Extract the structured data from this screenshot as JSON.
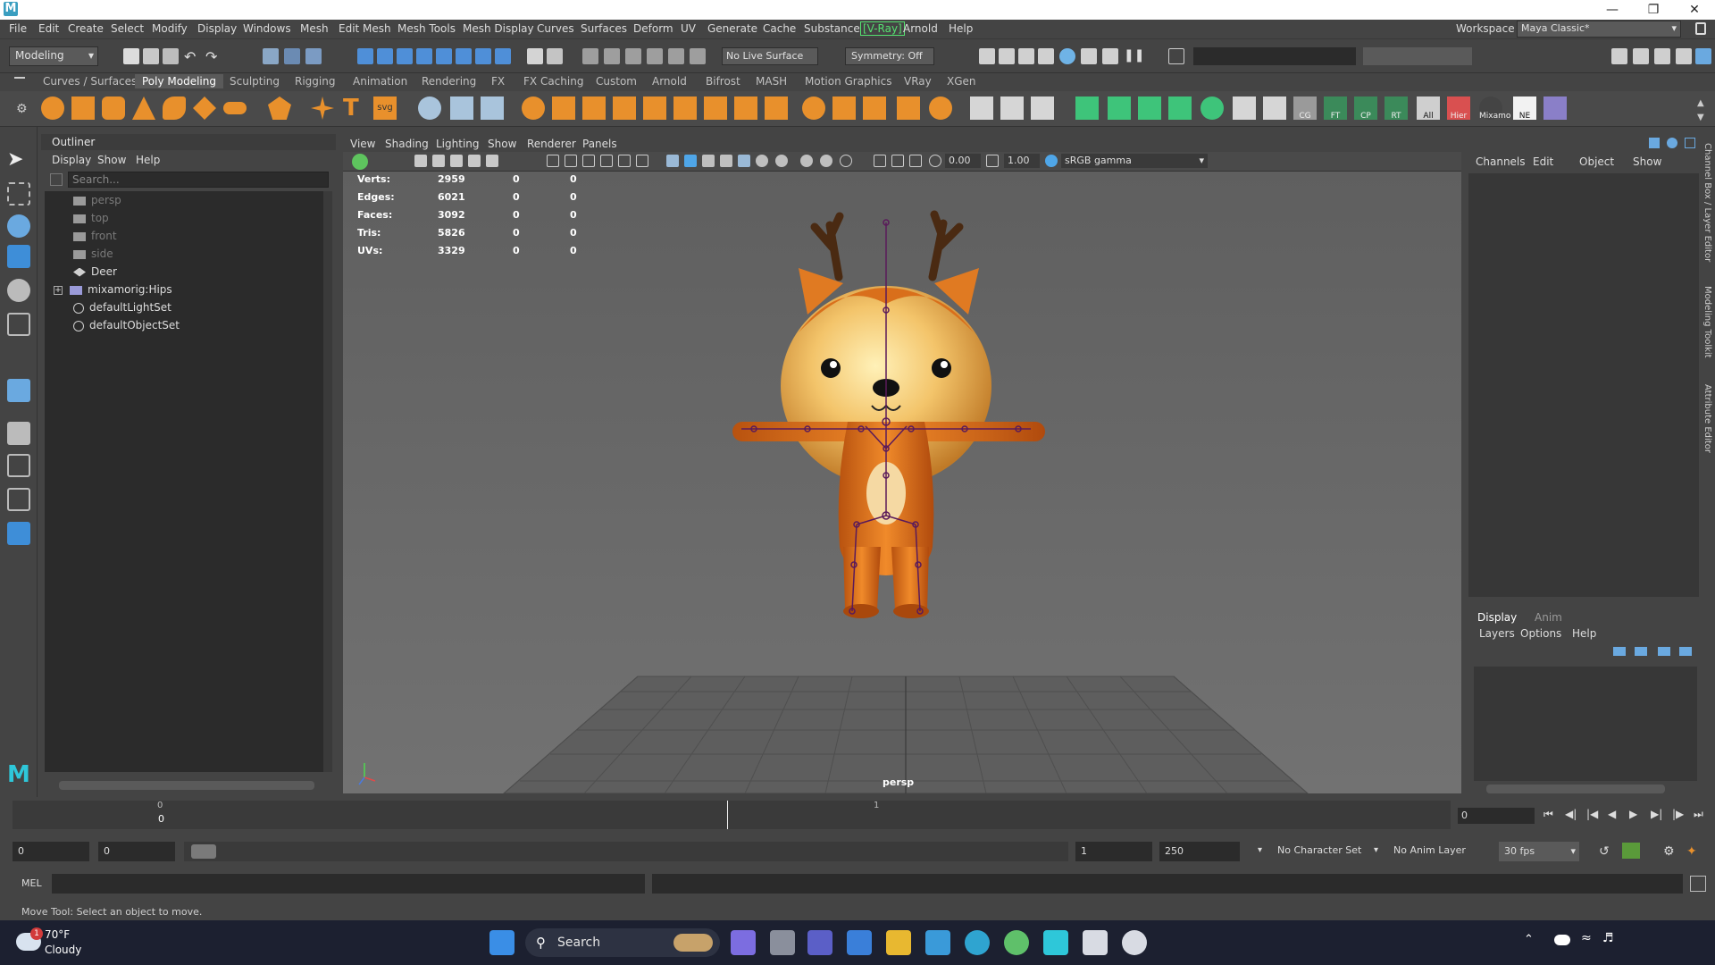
{
  "titlebar": {
    "app_icon": "M",
    "minimize_icon": "minimize-icon",
    "maximize_icon": "restore-icon",
    "close_icon": "close-icon"
  },
  "menubar": {
    "items": [
      "File",
      "Edit",
      "Create",
      "Select",
      "Modify",
      "Display",
      "Windows",
      "Mesh",
      "Edit Mesh",
      "Mesh Tools",
      "Mesh Display",
      "Curves",
      "Surfaces",
      "Deform",
      "UV",
      "Generate",
      "Cache",
      "Substance",
      "[V-Ray]",
      "Arnold",
      "Help"
    ],
    "workspace_label": "Workspace :",
    "workspace_value": "Maya Classic*"
  },
  "statusline": {
    "menuset": "Modeling",
    "live_surface": "No Live Surface",
    "symmetry": "Symmetry: Off"
  },
  "shelf": {
    "tabs": [
      "Curves / Surfaces",
      "Poly Modeling",
      "Sculpting",
      "Rigging",
      "Animation",
      "Rendering",
      "FX",
      "FX Caching",
      "Custom",
      "Arnold",
      "Bifrost",
      "MASH",
      "Motion Graphics",
      "VRay",
      "XGen"
    ],
    "active_tab": "Poly Modeling",
    "labeled_icons": [
      "CG",
      "FT",
      "CP",
      "RT",
      "All",
      "Hier",
      "Mixamo",
      "NE"
    ]
  },
  "outliner": {
    "title": "Outliner",
    "menu": [
      "Display",
      "Show",
      "Help"
    ],
    "search_placeholder": "Search...",
    "items": [
      {
        "label": "persp",
        "icon": "camera-icon",
        "dim": true
      },
      {
        "label": "top",
        "icon": "camera-icon",
        "dim": true
      },
      {
        "label": "front",
        "icon": "camera-icon",
        "dim": true
      },
      {
        "label": "side",
        "icon": "camera-icon",
        "dim": true
      },
      {
        "label": "Deer",
        "icon": "mesh-icon",
        "dim": false
      },
      {
        "label": "mixamorig:Hips",
        "icon": "joint-icon",
        "dim": false
      },
      {
        "label": "defaultLightSet",
        "icon": "set-icon",
        "dim": false
      },
      {
        "label": "defaultObjectSet",
        "icon": "set-icon",
        "dim": false
      }
    ]
  },
  "viewport": {
    "menu": [
      "View",
      "Shading",
      "Lighting",
      "Show",
      "Renderer",
      "Panels"
    ],
    "exposure": "0.00",
    "gamma": "1.00",
    "color_space": "sRGB gamma",
    "camera_label": "persp",
    "hud": [
      {
        "label": "Verts:",
        "a": "2959",
        "b": "0",
        "c": "0"
      },
      {
        "label": "Edges:",
        "a": "6021",
        "b": "0",
        "c": "0"
      },
      {
        "label": "Faces:",
        "a": "3092",
        "b": "0",
        "c": "0"
      },
      {
        "label": "Tris:",
        "a": "5826",
        "b": "0",
        "c": "0"
      },
      {
        "label": "UVs:",
        "a": "3329",
        "b": "0",
        "c": "0"
      }
    ]
  },
  "channelbox": {
    "menu": [
      "Channels",
      "Edit",
      "Object",
      "Show"
    ],
    "side_tabs": [
      "Channel Box / Layer Editor",
      "Modeling Toolkit",
      "Attribute Editor"
    ]
  },
  "layereditor": {
    "tabs": [
      "Display",
      "Anim"
    ],
    "menu": [
      "Layers",
      "Options",
      "Help"
    ]
  },
  "timeslider": {
    "tick_start": "0",
    "tick_start_b": "0",
    "tick_1": "1",
    "current_frame": "0"
  },
  "rangeslider": {
    "start": "0",
    "start_b": "0",
    "end_a": "1",
    "end_b": "250",
    "character_set": "No Character Set",
    "anim_layer": "No Anim Layer",
    "fps": "30 fps"
  },
  "cmdline": {
    "label": "MEL"
  },
  "helpline": {
    "text": "Move Tool: Select an object to move."
  },
  "taskbar": {
    "weather_temp": "70°F",
    "weather_desc": "Cloudy",
    "weather_badge": "1",
    "search_label": "Search",
    "accent": "#3a9ec0"
  }
}
